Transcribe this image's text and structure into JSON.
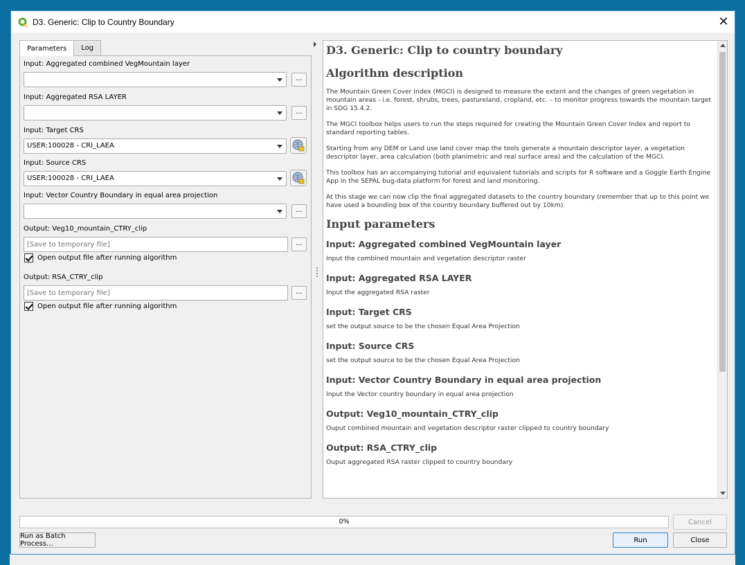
{
  "window": {
    "title": "D3. Generic:  Clip to Country Boundary",
    "close_glyph": "✕"
  },
  "tabs": [
    {
      "label": "Parameters",
      "active": true
    },
    {
      "label": "Log",
      "active": false
    }
  ],
  "params": {
    "p1_label": "Input: Aggregated  combined VegMountain layer",
    "p1_value": "",
    "p2_label": "Input: Aggregated RSA LAYER",
    "p2_value": "",
    "p3_label": "Input: Target CRS",
    "p3_value": "USER:100028 - CRI_LAEA",
    "p4_label": "Input: Source CRS",
    "p4_value": "USER:100028 - CRI_LAEA",
    "p5_label": "Input: Vector Country Boundary in equal area projection",
    "p5_value": "",
    "out1_label": "Output: Veg10_mountain_CTRY_clip",
    "out1_placeholder": "[Save to temporary file]",
    "out1_open_label": "Open output file after running algorithm",
    "out2_label": "Output: RSA_CTRY_clip",
    "out2_placeholder": "[Save to temporary file]",
    "out2_open_label": "Open output file after running algorithm",
    "dots": "..."
  },
  "help": {
    "title": "D3. Generic: Clip to country boundary",
    "desc_heading": "Algorithm description",
    "desc_p1": "The Mountain Green Cover Index (MGCI) is designed to measure the extent and the changes of green vegetation in mountain areas - i.e. forest, shrubs, trees, pastureland, cropland, etc. – to monitor progress towards the mountain target in SDG 15.4.2.",
    "desc_p2": "The MGCI toolbox helps users to run the steps required for creating the Mountain Green Cover Index and report to standard reporting tables.",
    "desc_p3": "Starting from any DEM or Land use land cover map the tools generate a mountain descriptor layer, a vegetation descriptor layer, area calculation (both planimetric and real surface area) and the calculation of the MGCI.",
    "desc_p4": "This toolbox has an accompanying tutorial and equivalent tutorials and scripts for R software and a Goggle Earth Engine App in the SEPAL bug-data platform for forest and land monitoring.",
    "desc_p5": "At this stage we can now clip the final aggregated datasets to the country boundary (remember that up to this point we have used a bounding box of the country boundary buffered out by 10km).",
    "params_heading": "Input parameters",
    "items": [
      {
        "h": "Input: Aggregated combined VegMountain layer",
        "d": "Input the combined mountain and vegetation descriptor raster"
      },
      {
        "h": "Input: Aggregated RSA LAYER",
        "d": "Input the aggregated RSA raster"
      },
      {
        "h": "Input: Target CRS",
        "d": "set the output source to be the chosen Equal Area Projection"
      },
      {
        "h": "Input: Source CRS",
        "d": "set the output source to be the chosen Equal Area Projection"
      },
      {
        "h": "Input: Vector Country Boundary in equal area projection",
        "d": "Input the Vector country boundary in equal area projection"
      },
      {
        "h": "Output: Veg10_mountain_CTRY_clip",
        "d": "Ouput combined mountain and vegetation descriptor raster clipped to country boundary"
      },
      {
        "h": "Output: RSA_CTRY_clip",
        "d": "Ouput aggregated RSA raster clipped to country boundary"
      }
    ]
  },
  "progress": {
    "value": 0,
    "label": "0%"
  },
  "buttons": {
    "cancel": "Cancel",
    "batch": "Run as Batch Process…",
    "run": "Run",
    "close": "Close"
  }
}
